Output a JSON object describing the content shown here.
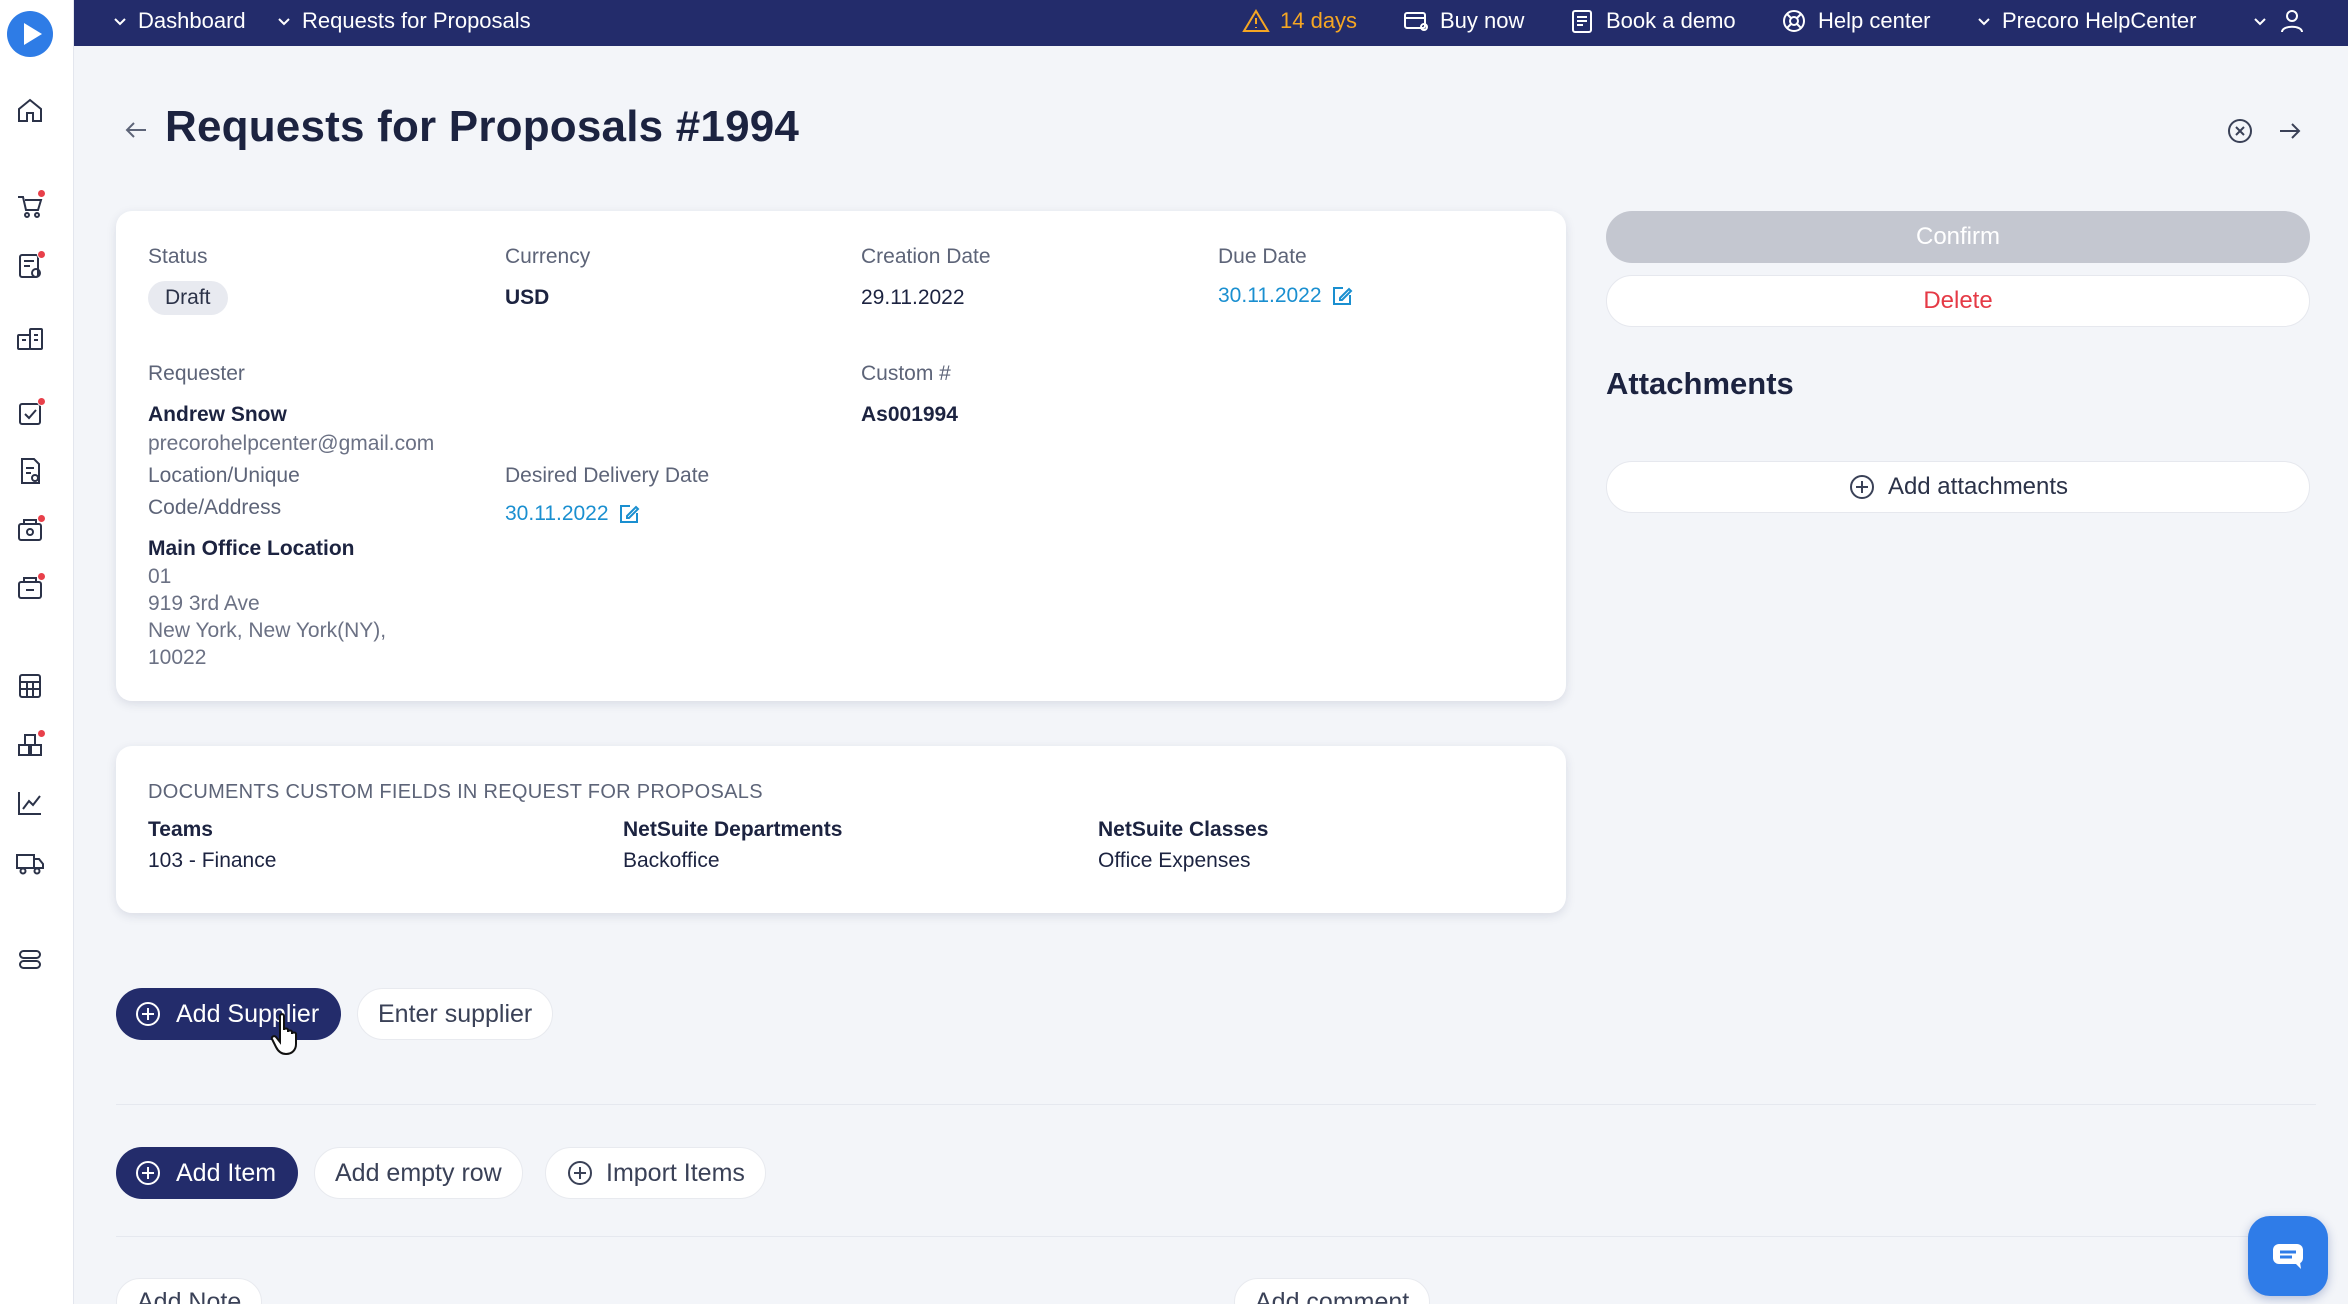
{
  "topbar": {
    "nav_dashboard": "Dashboard",
    "nav_current": "Requests for Proposals",
    "trial_days": "14 days",
    "buy_now": "Buy now",
    "book_demo": "Book a demo",
    "help_center": "Help center",
    "company": "Precoro HelpCenter"
  },
  "page": {
    "title": "Requests for Proposals #1994"
  },
  "details": {
    "status_label": "Status",
    "status_value": "Draft",
    "currency_label": "Currency",
    "currency_value": "USD",
    "creation_label": "Creation Date",
    "creation_value": "29.11.2022",
    "due_label": "Due Date",
    "due_value": "30.11.2022",
    "requester_label": "Requester",
    "requester_name": "Andrew Snow",
    "requester_email": "precorohelpcenter@gmail.com",
    "custom_label": "Custom #",
    "custom_value": "As001994",
    "location_label_1": "Location/Unique",
    "location_label_2": "Code/Address",
    "location_name": "Main Office Location",
    "location_code": "01",
    "location_street": "919 3rd Ave",
    "location_city": "New York, New York(NY),",
    "location_zip": "10022",
    "delivery_label": "Desired Delivery Date",
    "delivery_value": "30.11.2022"
  },
  "custom_fields": {
    "heading": "DOCUMENTS CUSTOM FIELDS IN REQUEST FOR PROPOSALS",
    "teams_label": "Teams",
    "teams_value": "103 - Finance",
    "dept_label": "NetSuite Departments",
    "dept_value": "Backoffice",
    "classes_label": "NetSuite Classes",
    "classes_value": "Office Expenses"
  },
  "side_panel": {
    "confirm": "Confirm",
    "delete": "Delete",
    "attachments_title": "Attachments",
    "add_attachments": "Add attachments"
  },
  "actions": {
    "add_supplier": "Add Supplier",
    "enter_supplier": "Enter supplier",
    "add_item": "Add Item",
    "add_empty_row": "Add empty row",
    "import_items": "Import Items",
    "add_note": "Add Note",
    "add_comment": "Add comment"
  },
  "colors": {
    "navy": "#232c6b",
    "link": "#1a8fd0",
    "danger": "#e53a46",
    "warning": "#f5a623",
    "chat": "#2f7ce8"
  }
}
